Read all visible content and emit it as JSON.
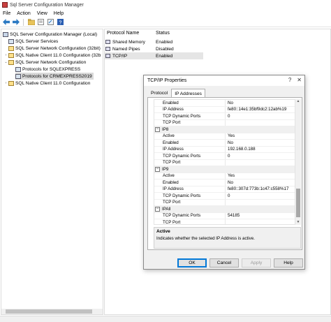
{
  "window": {
    "title": "Sql Server Configuration Manager"
  },
  "menu": [
    "File",
    "Action",
    "View",
    "Help"
  ],
  "toolbar": {
    "icons": [
      "back-arrow-icon",
      "forward-arrow-icon",
      "folder-up-icon",
      "properties-icon",
      "export-icon",
      "help-icon"
    ]
  },
  "tree": {
    "items": [
      {
        "label": "SQL Server Configuration Manager (Local)",
        "indent": 0,
        "expander": ""
      },
      {
        "label": "SQL Server Services",
        "indent": 1,
        "expander": ""
      },
      {
        "label": "SQL Server Network Configuration (32bit)",
        "indent": 1,
        "expander": ""
      },
      {
        "label": "SQL Native Client 11.0 Configuration (32b",
        "indent": 1,
        "expander": "›"
      },
      {
        "label": "SQL Server Network Configuration",
        "indent": 1,
        "expander": "⌄"
      },
      {
        "label": "Protocols for SQLEXPRESS",
        "indent": 2,
        "expander": ""
      },
      {
        "label": "Protocols for CRMEXPRESS2019",
        "indent": 2,
        "expander": "",
        "selected": true
      },
      {
        "label": "SQL Native Client 11.0 Configuration",
        "indent": 1,
        "expander": "›"
      }
    ]
  },
  "list": {
    "columns": [
      "Protocol Name",
      "Status"
    ],
    "rows": [
      {
        "name": "Shared Memory",
        "status": "Enabled"
      },
      {
        "name": "Named Pipes",
        "status": "Disabled"
      },
      {
        "name": "TCP/IP",
        "status": "Enabled",
        "selected": true
      }
    ]
  },
  "dialog": {
    "title": "TCP/IP Properties",
    "help_glyph": "?",
    "close_glyph": "✕",
    "tabs": [
      {
        "label": "Protocol",
        "active": false
      },
      {
        "label": "IP Addresses",
        "active": true
      }
    ],
    "grid": [
      {
        "type": "prop",
        "key": "Enabled",
        "value": "No"
      },
      {
        "type": "prop",
        "key": "IP Address",
        "value": "fe80::14e1:35bf9dc2:12ab%19"
      },
      {
        "type": "prop",
        "key": "TCP Dynamic Ports",
        "value": "0"
      },
      {
        "type": "prop",
        "key": "TCP Port",
        "value": ""
      },
      {
        "type": "cat",
        "key": "IP8",
        "value": ""
      },
      {
        "type": "prop",
        "key": "Active",
        "value": "Yes"
      },
      {
        "type": "prop",
        "key": "Enabled",
        "value": "No"
      },
      {
        "type": "prop",
        "key": "IP Address",
        "value": "192.168.0.188"
      },
      {
        "type": "prop",
        "key": "TCP Dynamic Ports",
        "value": "0"
      },
      {
        "type": "prop",
        "key": "TCP Port",
        "value": ""
      },
      {
        "type": "cat",
        "key": "IP9",
        "value": ""
      },
      {
        "type": "prop",
        "key": "Active",
        "value": "Yes"
      },
      {
        "type": "prop",
        "key": "Enabled",
        "value": "No"
      },
      {
        "type": "prop",
        "key": "IP Address",
        "value": "fe80::307d:773b:1c47:c558%17"
      },
      {
        "type": "prop",
        "key": "TCP Dynamic Ports",
        "value": "0"
      },
      {
        "type": "prop",
        "key": "TCP Port",
        "value": ""
      },
      {
        "type": "cat",
        "key": "IPAll",
        "value": ""
      },
      {
        "type": "prop",
        "key": "TCP Dynamic Ports",
        "value": "54185"
      },
      {
        "type": "prop",
        "key": "TCP Port",
        "value": ""
      }
    ],
    "description": {
      "title": "Active",
      "text": "Indicates whether the selected IP Address is active."
    },
    "buttons": {
      "ok": "OK",
      "cancel": "Cancel",
      "apply": "Apply",
      "help": "Help"
    }
  }
}
